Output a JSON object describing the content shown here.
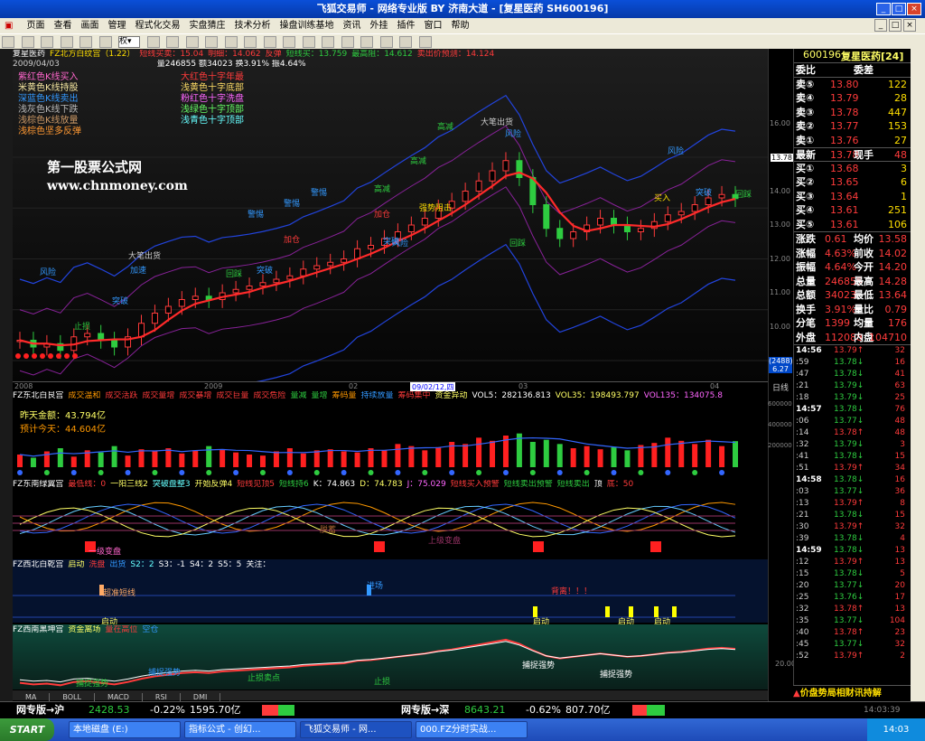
{
  "window": {
    "title": "飞狐交易师 - 网络专业版 BY 济南大道 - [复星医药 SH600196]"
  },
  "menu": [
    "页面",
    "查看",
    "画面",
    "管理",
    "程式化交易",
    "实盘猜庄",
    "技术分析",
    "操盘训练基地",
    "资讯",
    "外挂",
    "插件",
    "窗口",
    "帮助"
  ],
  "toolbar": {
    "quan": "权"
  },
  "chart": {
    "header": [
      "复星医药",
      "FZ北方白纹宫（1.22）",
      "短线买卖：15.04",
      "明细：14.062",
      "反弹",
      "短线买：13.759",
      "最高阻：14.612",
      "卖出价预测：14.124"
    ],
    "subheader": {
      "date": "2009/04/03",
      "stats": "量246855 额34023 换3.91% 振4.64%"
    },
    "legend": [
      "紫红色K线买入",
      "米黄色K线持股",
      "深蓝色K线卖出",
      "浅灰色K线下跌",
      "浅棕色K线放量",
      "浅棕色坚多反弹",
      "大红色十字年最",
      "浅黄色十字底部",
      "粉红色十字洗盘",
      "浅绿色十字顶部",
      "浅青色十字顶部"
    ],
    "watermark1": "第一股票公式网",
    "watermark2": "www.chnmoney.com",
    "annotations": [
      "大笔出货",
      "大笔出货",
      "风险",
      "风险",
      "风险",
      "风险",
      "高减",
      "高减",
      "高减",
      "警惕",
      "警惕",
      "警惕",
      "加仓",
      "加仓",
      "加速",
      "突破",
      "突破",
      "突破",
      "回踩",
      "回踩",
      "强势阻击",
      "买入",
      "突破",
      "回踩",
      "止损"
    ],
    "y_labels": [
      "16.00",
      "15.00",
      "14.00",
      "13.00",
      "12.00",
      "11.00",
      "10.00",
      "9.00"
    ],
    "last_price": "13.78",
    "x_labels": [
      "2008",
      "2009",
      "02",
      "03",
      "04"
    ],
    "cursor_date": "09/02/12,四",
    "side_box1": "(2488)",
    "side_box2": "6.27",
    "side_unit": "日线"
  },
  "vol": {
    "header": [
      "FZ东北白艮宫",
      "成交温和",
      "成交活跃",
      "成交量增",
      "成交暴增",
      "成交巨量",
      "成交危险",
      "量减",
      "量增",
      "筹码量",
      "持续放量",
      "筹码集中",
      "资金异动",
      "VOL5：282136.813",
      "VOL35：198493.797",
      "VOL135：134075.8"
    ],
    "inner1": "昨天金额：43.794亿",
    "inner2": "预计今天：44.604亿",
    "y_labels": [
      "600000",
      "400000",
      "200000"
    ]
  },
  "kdj": {
    "header": [
      "FZ东南绿翼宫",
      "最低线：0",
      "一阳三线2",
      "突破盘整3",
      "开始反弹4",
      "短线见顶5",
      "短线持6",
      "K：74.863",
      "D：74.783",
      "J：75.029",
      "短线买入预警",
      "短线卖出预警",
      "短线卖出",
      "顶",
      "底：50"
    ],
    "labels": [
      "脱蓄",
      "上级变盘",
      "一级变盘"
    ]
  },
  "sig": {
    "header": [
      "FZ西北白乾宫",
      "启动",
      "洗盘",
      "出货",
      "S2：2",
      "S3：-1",
      "S4：2",
      "S5：5",
      "关注："
    ],
    "labels": [
      "超准短线",
      "进场",
      "背离！！！",
      "启动",
      "启动",
      "启动",
      "启动"
    ]
  },
  "hl": {
    "header": [
      "FZ西南黑坤宫",
      "资金离场",
      "量在高位",
      "空仓"
    ],
    "labels": [
      "捕捉强势",
      "捕捉强势",
      "止损卖点",
      "捕捉强势",
      "止损",
      "捕捉强势"
    ],
    "y_labels": [
      "20.00"
    ]
  },
  "tabs": [
    "MA",
    "BOLL",
    "MACD",
    "RSI",
    "DMI"
  ],
  "right": {
    "code": "600196",
    "name": "复星医药[24]",
    "wei": {
      "l1": "委比",
      "l2": "委差"
    },
    "sells": [
      {
        "l": "卖⑤",
        "p": "13.80",
        "v": "122"
      },
      {
        "l": "卖④",
        "p": "13.79",
        "v": "28"
      },
      {
        "l": "卖③",
        "p": "13.78",
        "v": "447"
      },
      {
        "l": "卖②",
        "p": "13.77",
        "v": "153"
      },
      {
        "l": "卖①",
        "p": "13.76",
        "v": "27"
      }
    ],
    "latest": {
      "l": "最新",
      "p": "13.78",
      "l2": "现手",
      "v": "48"
    },
    "buys": [
      {
        "l": "买①",
        "p": "13.68",
        "v": "3"
      },
      {
        "l": "买②",
        "p": "13.65",
        "v": "6"
      },
      {
        "l": "买③",
        "p": "13.64",
        "v": "1"
      },
      {
        "l": "买④",
        "p": "13.61",
        "v": "251"
      },
      {
        "l": "买⑤",
        "p": "13.61",
        "v": "106"
      }
    ],
    "quote": [
      {
        "a": "涨跌",
        "av": "0.61",
        "b": "均价",
        "bv": "13.58"
      },
      {
        "a": "涨幅",
        "av": "4.63%",
        "b": "前收",
        "bv": "14.02"
      },
      {
        "a": "振幅",
        "av": "4.64%",
        "b": "今开",
        "bv": "14.20"
      },
      {
        "a": "总量",
        "av": "246855",
        "b": "最高",
        "bv": "14.28"
      },
      {
        "a": "总额",
        "av": "34023",
        "b": "最低",
        "bv": "13.64"
      },
      {
        "a": "换手",
        "av": "3.91%",
        "b": "量比",
        "bv": "0.79"
      },
      {
        "a": "分笔",
        "av": "1399",
        "b": "均量",
        "bv": "176"
      },
      {
        "a": "外盘",
        "av": "112088",
        "b": "内盘",
        "bv": "104710"
      }
    ],
    "ticks": [
      {
        "t": "14:56",
        "p": "13.79↑",
        "v": "32"
      },
      {
        "t": ":59",
        "p": "13.78↓",
        "v": "16"
      },
      {
        "t": ":47",
        "p": "13.78↓",
        "v": "41"
      },
      {
        "t": ":21",
        "p": "13.79↓",
        "v": "63"
      },
      {
        "t": ":18",
        "p": "13.79↓",
        "v": "25"
      },
      {
        "t": "14:57",
        "p": "13.78↓",
        "v": "76"
      },
      {
        "t": ":06",
        "p": "13.77↓",
        "v": "48"
      },
      {
        "t": ":14",
        "p": "13.78↑",
        "v": "48"
      },
      {
        "t": ":32",
        "p": "13.79↓",
        "v": "3"
      },
      {
        "t": ":41",
        "p": "13.78↓",
        "v": "15"
      },
      {
        "t": ":51",
        "p": "13.79↑",
        "v": "34"
      },
      {
        "t": "14:58",
        "p": "13.78↓",
        "v": "16"
      },
      {
        "t": ":03",
        "p": "13.77↓",
        "v": "36"
      },
      {
        "t": ":13",
        "p": "13.79↑",
        "v": "8"
      },
      {
        "t": ":21",
        "p": "13.78↓",
        "v": "15"
      },
      {
        "t": ":30",
        "p": "13.79↑",
        "v": "32"
      },
      {
        "t": ":39",
        "p": "13.78↓",
        "v": "4"
      },
      {
        "t": "14:59",
        "p": "13.78↓",
        "v": "13"
      },
      {
        "t": ":12",
        "p": "13.79↑",
        "v": "13"
      },
      {
        "t": ":15",
        "p": "13.78↓",
        "v": "5"
      },
      {
        "t": ":20",
        "p": "13.77↓",
        "v": "20"
      },
      {
        "t": ":25",
        "p": "13.76↓",
        "v": "17"
      },
      {
        "t": ":32",
        "p": "13.78↑",
        "v": "13"
      },
      {
        "t": ":35",
        "p": "13.77↓",
        "v": "104"
      },
      {
        "t": ":40",
        "p": "13.78↑",
        "v": "23"
      },
      {
        "t": ":45",
        "p": "13.77↓",
        "v": "32"
      },
      {
        "t": ":52",
        "p": "13.79↑",
        "v": "2"
      }
    ],
    "bottom": "价盘势局相财讯持解",
    "clock": "14:03:39"
  },
  "statusbar": {
    "sh_label": "网专版→沪",
    "sh_idx": "2428.53",
    "sh_chg": "-0.22%",
    "sh_amt": "1595.70亿",
    "sz_label": "网专版→深",
    "sz_idx": "8643.21",
    "sz_chg": "-0.62%",
    "sz_amt": "807.70亿"
  },
  "taskbar": {
    "start": "START",
    "items": [
      "本地磁盘 (E:)",
      "指标公式 - 创幻...",
      "飞狐交易师 - 网...",
      "000.FZ分时实战..."
    ],
    "time": "14:03"
  },
  "colors": {
    "up": "#ff3b3b",
    "down": "#2ecc40",
    "yellow": "#ffdf00"
  },
  "chart_data": {
    "type": "candlestick",
    "note": "",
    "y_range": [
      8.6,
      16.6
    ],
    "closes": [
      9.6,
      9.4,
      9.5,
      9.3,
      9.7,
      9.8,
      9.6,
      9.4,
      9.7,
      10.1,
      10.4,
      10.6,
      10.8,
      10.9,
      10.8,
      11.0,
      11.1,
      11.2,
      11.3,
      11.4,
      11.5,
      11.7,
      11.8,
      11.9,
      12.0,
      12.3,
      12.4,
      12.6,
      12.8,
      13.0,
      13.2,
      13.5,
      13.7,
      14.0,
      14.3,
      14.6,
      14.9,
      14.4,
      13.6,
      12.9,
      12.6,
      12.8,
      13.0,
      13.2,
      13.0,
      12.8,
      12.9,
      13.1,
      13.3,
      13.4,
      13.6,
      13.8,
      13.9,
      13.78
    ],
    "volumes": [
      120000,
      90000,
      150000,
      180000,
      100000,
      160000,
      140000,
      200000,
      110000,
      170000,
      150000,
      180000,
      130000,
      160000,
      200000,
      170000,
      140000,
      120000,
      110000,
      150000,
      180000,
      130000,
      160000,
      170000,
      150000,
      140000,
      180000,
      160000,
      220000,
      200000,
      160000,
      190000,
      240000,
      220000,
      280000,
      250000,
      300000,
      320000,
      240000,
      260000,
      220000,
      180000,
      200000,
      170000,
      190000,
      160000,
      210000,
      230000,
      280000,
      250000,
      220000,
      260000,
      200000,
      246855
    ]
  }
}
